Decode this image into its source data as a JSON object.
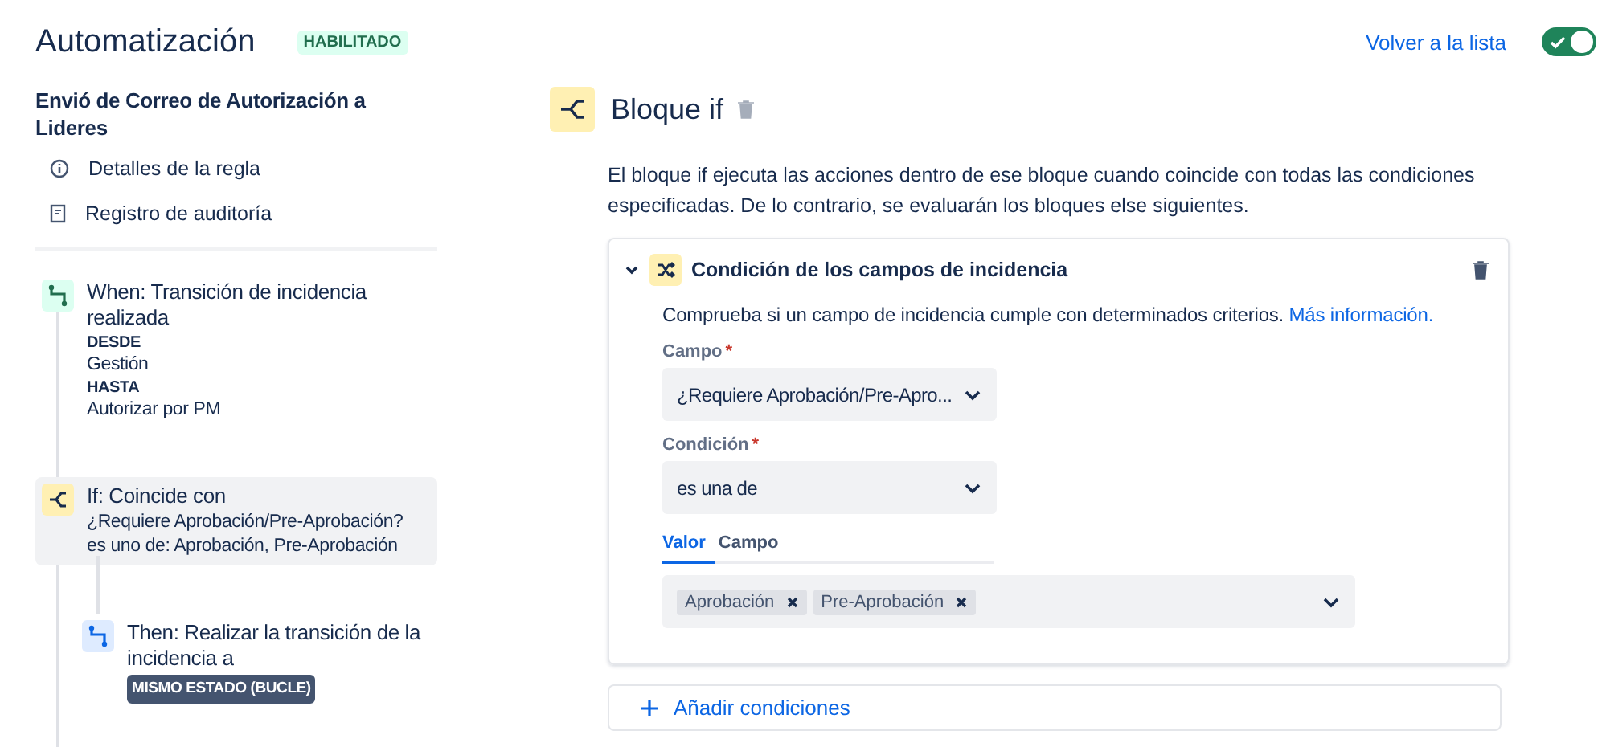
{
  "header": {
    "title": "Automatización",
    "status": "HABILITADO",
    "back_link": "Volver a la lista",
    "enabled_toggle": {
      "on": true
    }
  },
  "rule": {
    "name": "Envió de Correo de Autorización a Lideres",
    "menu": [
      {
        "kind": "info",
        "label": "Detalles de la regla"
      },
      {
        "kind": "log",
        "label": "Registro de auditoría"
      }
    ]
  },
  "steps": [
    {
      "kind": "when",
      "selected": false,
      "title": "When: Transición de incidencia realizada",
      "details": [
        {
          "kind": "heading",
          "text": "DESDE"
        },
        {
          "kind": "value",
          "text": "Gestión"
        },
        {
          "kind": "heading",
          "text": "HASTA"
        },
        {
          "kind": "value",
          "text": "Autorizar por PM"
        }
      ]
    },
    {
      "kind": "if",
      "selected": true,
      "title": "If: Coincide con",
      "details": [
        {
          "kind": "value",
          "text": "¿Requiere Aprobación/Pre-Aprobación?"
        },
        {
          "kind": "value",
          "text": "es uno de: Aprobación, Pre-Aprobación"
        }
      ]
    },
    {
      "kind": "then",
      "selected": false,
      "title": "Then: Realizar la transición de la incidencia a",
      "details": [
        {
          "kind": "lozenge",
          "text": "MISMO ESTADO (BUCLE)"
        }
      ]
    }
  ],
  "panel": {
    "title": "Bloque if",
    "description": "El bloque if ejecuta las acciones dentro de ese bloque cuando coincide con todas las condiciones especificadas. De lo contrario, se evaluarán los bloques else siguientes.",
    "condition": {
      "title": "Condición de los campos de incidencia",
      "expanded": true,
      "description": "Comprueba si un campo de incidencia cumple con determinados criterios.",
      "link": "Más información.",
      "fields": [
        {
          "label": "Campo",
          "required_mark": "*",
          "value": "¿Requiere Aprobación/Pre-Apro..."
        },
        {
          "label": "Condición",
          "required_mark": "*",
          "value": "es una de"
        }
      ],
      "tabs": [
        {
          "label": "Valor",
          "selected": true
        },
        {
          "label": "Campo",
          "selected": false
        }
      ],
      "values": [
        "Aprobación",
        "Pre-Aprobación"
      ]
    },
    "add_button": "Añadir condiciones"
  }
}
